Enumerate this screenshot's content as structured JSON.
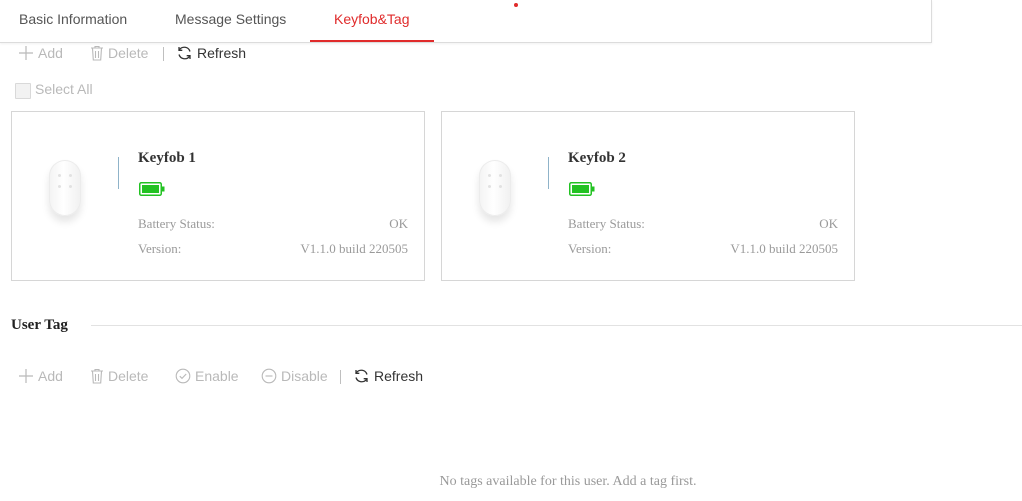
{
  "tabs": [
    {
      "label": "Basic Information"
    },
    {
      "label": "Message Settings"
    },
    {
      "label": "Keyfob&Tag",
      "active": true
    }
  ],
  "keyfob_toolbar": {
    "add_label": "Add",
    "delete_label": "Delete",
    "refresh_label": "Refresh"
  },
  "select_all_label": "Select All",
  "keyfobs": [
    {
      "name": "Keyfob 1",
      "battery_status_label": "Battery Status:",
      "battery_status": "OK",
      "version_label": "Version:",
      "version": "V1.1.0 build 220505"
    },
    {
      "name": "Keyfob 2",
      "battery_status_label": "Battery Status:",
      "battery_status": "OK",
      "version_label": "Version:",
      "version": "V1.1.0 build 220505"
    }
  ],
  "user_tag": {
    "title": "User Tag",
    "toolbar": {
      "add_label": "Add",
      "delete_label": "Delete",
      "enable_label": "Enable",
      "disable_label": "Disable",
      "refresh_label": "Refresh"
    },
    "empty_message": "No tags available for this user. Add a tag first."
  },
  "colors": {
    "accent": "#e02b2b",
    "battery": "#22c222",
    "disabled": "#b9b9b9"
  },
  "icons": {
    "add": "plus-icon",
    "delete": "trash-icon",
    "refresh": "refresh-icon",
    "enable": "check-circle-icon",
    "disable": "minus-circle-icon",
    "battery": "battery-full-icon"
  }
}
